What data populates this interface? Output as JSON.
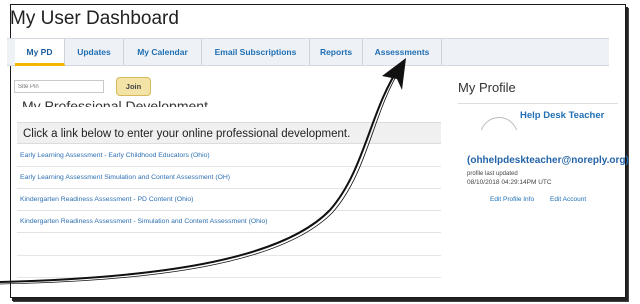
{
  "page": {
    "title": "My User Dashboard"
  },
  "tabs": [
    {
      "label": "My PD",
      "active": true
    },
    {
      "label": "Updates",
      "active": false
    },
    {
      "label": "My Calendar",
      "active": false
    },
    {
      "label": "Email Subscriptions",
      "active": false
    },
    {
      "label": "Reports",
      "active": false
    },
    {
      "label": "Assessments",
      "active": false
    }
  ],
  "site_pin": {
    "placeholder": "Site Pin",
    "join_label": "Join"
  },
  "professional_development": {
    "heading": "My Professional Development",
    "instruction": "Click a link below to enter your online professional development.",
    "courses": [
      "Early Learning Assessment - Early Childhood Educators (Ohio)",
      "Early Learning Assessment Simulation and Content Assessment (OH)",
      "Kindergarten Readiness Assessment - PD Content (Ohio)",
      "Kindergarten Readiness Assessment - Simulation and Content Assessment (Ohio)"
    ]
  },
  "profile": {
    "title": "My Profile",
    "name": "Help Desk Teacher",
    "email": "(ohhelpdeskteacher@noreply.org)",
    "last_updated_label": "profile last updated",
    "last_updated": "08/10/2018 04:29:14PM UTC",
    "edit_profile": "Edit Profile Info",
    "edit_account": "Edit Account"
  },
  "colors": {
    "link": "#1f6fb5",
    "tab_active_underline": "#f2b705",
    "join_button": "#f4e3a6"
  },
  "annotation": {
    "icon": "curved-arrow-icon"
  }
}
